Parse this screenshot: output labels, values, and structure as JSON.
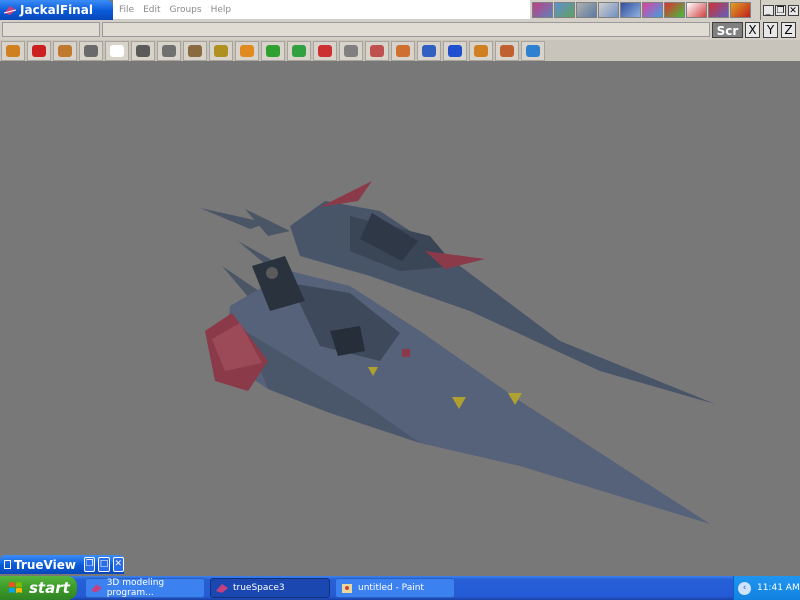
{
  "window": {
    "title": "JackalFinal"
  },
  "menu": {
    "items": [
      "File",
      "Edit",
      "Groups",
      "Help"
    ]
  },
  "top_icons": [
    "view-toolbar-icon-1",
    "view-toolbar-icon-2",
    "view-toolbar-icon-3",
    "view-toolbar-icon-4",
    "view-toolbar-icon-5",
    "view-toolbar-icon-6",
    "view-toolbar-icon-7",
    "view-toolbar-icon-8",
    "view-toolbar-icon-9",
    "view-toolbar-icon-10"
  ],
  "window_controls": {
    "minimize": "_",
    "restore": "❐",
    "close": "✕"
  },
  "coords": {
    "scr_label": "Scr",
    "x_label": "X",
    "y_label": "Y",
    "z_label": "Z"
  },
  "tools": [
    {
      "name": "undo-tool",
      "color": "#d08020"
    },
    {
      "name": "delete-tool",
      "color": "#cc2020"
    },
    {
      "name": "cube-object-tool",
      "color": "#c07a30"
    },
    {
      "name": "light-bulb-tool",
      "color": "#6a6a6a"
    },
    {
      "name": "select-arrow-tool",
      "color": "#ffffff"
    },
    {
      "name": "rotate-object-tool",
      "color": "#5a5a5a"
    },
    {
      "name": "move-up-tool",
      "color": "#707070"
    },
    {
      "name": "box-tool",
      "color": "#8a6a40"
    },
    {
      "name": "sweep-tool",
      "color": "#b09020"
    },
    {
      "name": "sphere-tool",
      "color": "#e08a20"
    },
    {
      "name": "material-tool",
      "color": "#30a030"
    },
    {
      "name": "deform-tool",
      "color": "#30a040"
    },
    {
      "name": "link-tool",
      "color": "#cc3030"
    },
    {
      "name": "path-tool",
      "color": "#808080"
    },
    {
      "name": "spline-tool",
      "color": "#c05050"
    },
    {
      "name": "brush-tool",
      "color": "#d07030"
    },
    {
      "name": "primitives-tool",
      "color": "#3060c0"
    },
    {
      "name": "axes-tool",
      "color": "#2050d0"
    },
    {
      "name": "lights-tool",
      "color": "#d08020"
    },
    {
      "name": "plane-tool",
      "color": "#c06030"
    },
    {
      "name": "3d-text-tool",
      "color": "#3080d0"
    }
  ],
  "trueview": {
    "label": "TrueView"
  },
  "taskbar": {
    "start_label": "start",
    "tasks": [
      {
        "label": "3D modeling program..."
      },
      {
        "label": "trueSpace3"
      },
      {
        "label": "untitled - Paint"
      }
    ],
    "clock": "11:41 AM"
  },
  "colors": {
    "viewport_bg": "#787878",
    "hull": "#4e5a6a",
    "hull_dark": "#34404e",
    "wing_red": "#8a3a48",
    "xp_blue": "#245ad6",
    "xp_green": "#3c9a29"
  }
}
